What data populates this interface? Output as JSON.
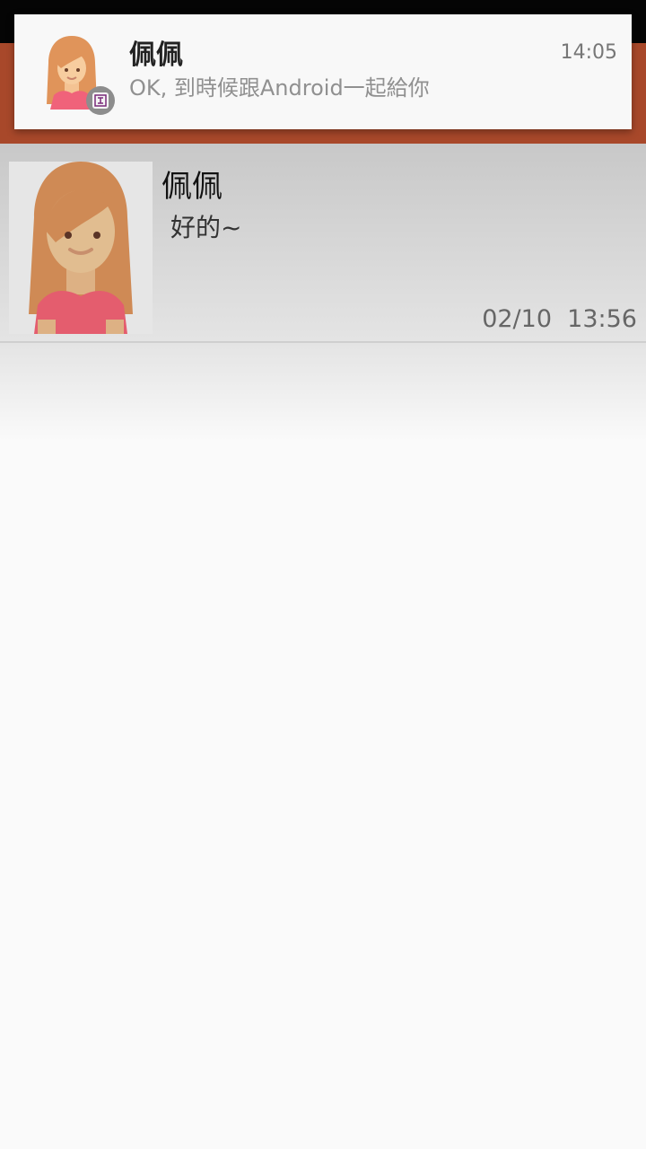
{
  "notification": {
    "sender": "佩佩",
    "message": "OK, 到時候跟Android一起給你",
    "time": "14:05",
    "avatar_icon": "girl-avatar-icon",
    "badge_icon": "app-badge-icon"
  },
  "chat_list": {
    "items": [
      {
        "name": "佩佩",
        "last_message": "好的~",
        "timestamp": "02/10  13:56",
        "avatar_icon": "girl-avatar-icon"
      }
    ]
  },
  "colors": {
    "status_bar": "#050505",
    "app_bar": "#a8482a",
    "notification_bg": "#f8f8f8",
    "row_bg": "#d6d6d6",
    "page_bg": "#fafafa"
  }
}
